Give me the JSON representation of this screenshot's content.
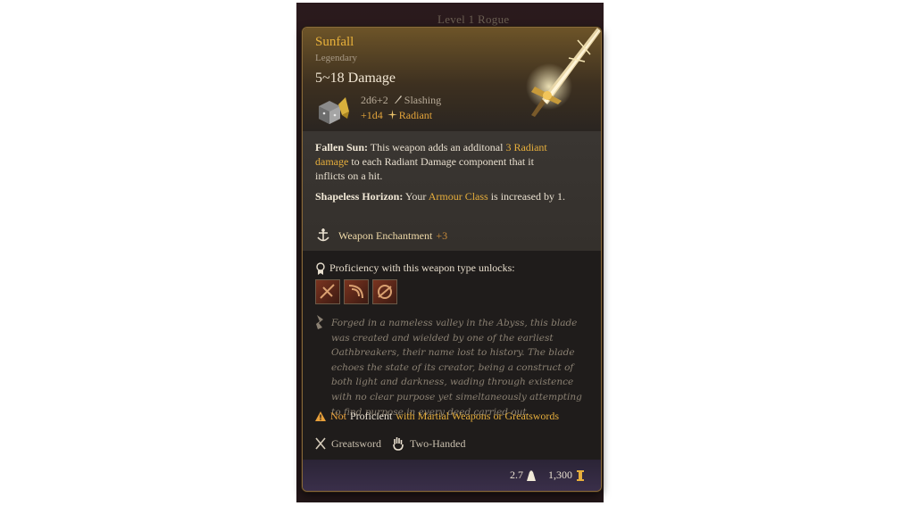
{
  "backdrop": {
    "label": "Level 1 Rogue"
  },
  "item": {
    "name": "Sunfall",
    "rarity": "Legendary",
    "damage_title": "5~18 Damage",
    "base_damage": {
      "dice": "2d6+2",
      "type": "Slashing"
    },
    "extra_damage": {
      "dice": "+1d4",
      "type": "Radiant"
    },
    "weapon_icon": "sword-art"
  },
  "properties": {
    "fallen_sun": {
      "name": "Fallen Sun:",
      "text_a": " This weapon adds an additonal ",
      "highlight": "3 Radiant damage",
      "text_b": " to each Radiant Damage component that it inflicts on a hit."
    },
    "shapeless_horizon": {
      "name": "Shapeless Horizon:",
      "text_a": " Your ",
      "highlight": "Armour Class",
      "text_b": " is increased by 1."
    },
    "enchantment": {
      "label": "Weapon Enchantment",
      "value": "+3"
    }
  },
  "proficiency": {
    "text": "Proficiency with this weapon type unlocks:",
    "actions": [
      "action-icon-1",
      "action-icon-2",
      "action-icon-3"
    ]
  },
  "lore": "Forged in a nameless valley in the Abyss, this blade was created and wielded by one of the earliest Oathbreakers, their name lost to history. The blade echoes the state of its creator, being a construct of both light and darkness, wading through existence with no clear purpose yet simeltaneously attempting to find purpose in every deed carried out.",
  "warning": {
    "not": "Not",
    "proficient": "Proficient",
    "rest": "with Martial Weapons or Greatswords"
  },
  "tags": [
    "Greatsword",
    "Two-Handed"
  ],
  "footer": {
    "weight": "2.7",
    "value": "1,300"
  },
  "colors": {
    "accent": "#e6ae3c",
    "border": "#8a6a3a",
    "lore": "#8a8072"
  }
}
